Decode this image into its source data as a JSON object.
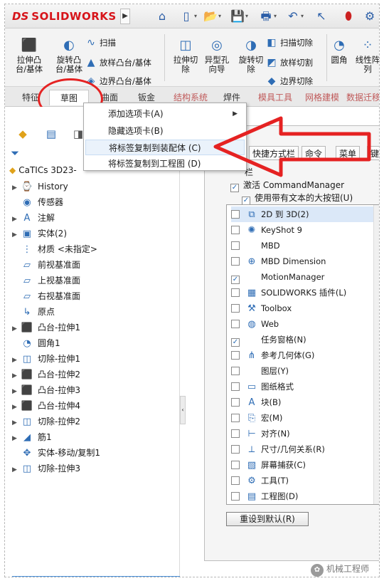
{
  "app": {
    "logo_ds": "DS",
    "logo_name": "SOLIDWORKS"
  },
  "quick_access": [
    "home-icon",
    "new-icon",
    "open-icon",
    "save-icon",
    "print-icon",
    "undo-icon",
    "traffic-light-icon"
  ],
  "ribbon": {
    "extrude_boss": "拉伸凸\n台/基体",
    "revolve_boss": "旋转凸\n台/基体",
    "sweep": "扫描",
    "loft_boss": "放样凸台/基体",
    "boundary_boss": "边界凸台/基体",
    "extrude_cut": "拉伸切\n除",
    "hole_wizard": "异型孔\n向导",
    "revolve_cut": "旋转切\n除",
    "sweep_cut": "扫描切除",
    "loft_cut": "放样切割",
    "boundary_cut": "边界切除",
    "fillet": "圆角",
    "linear_pattern": "线性阵\n列"
  },
  "tabs": [
    "特征",
    "草图",
    "曲面",
    "钣金",
    "结构系统",
    "焊件",
    "模具工具",
    "网格建模",
    "数据迁移"
  ],
  "context_menu": {
    "add_tab": "添加选项卡(A)",
    "hide_tab": "隐藏选项卡(B)",
    "copy_to_assembly": "将标签复制到装配体 (C)",
    "copy_to_drawing": "将标签复制到工程图 (D)"
  },
  "feature_tree": {
    "root": "CaTICs 3D23-",
    "items": [
      {
        "label": "History",
        "expand": true,
        "icon": "history-icon"
      },
      {
        "label": "传感器",
        "expand": false,
        "icon": "sensor-icon"
      },
      {
        "label": "注解",
        "expand": true,
        "icon": "annotation-icon"
      },
      {
        "label": "实体(2)",
        "expand": true,
        "icon": "solid-bodies-icon"
      },
      {
        "label": "材质 <未指定>",
        "expand": false,
        "icon": "material-icon"
      },
      {
        "label": "前视基准面",
        "expand": false,
        "icon": "plane-icon"
      },
      {
        "label": "上视基准面",
        "expand": false,
        "icon": "plane-icon"
      },
      {
        "label": "右视基准面",
        "expand": false,
        "icon": "plane-icon"
      },
      {
        "label": "原点",
        "expand": false,
        "icon": "origin-icon"
      },
      {
        "label": "凸台-拉伸1",
        "expand": true,
        "icon": "boss-extrude-icon"
      },
      {
        "label": "圆角1",
        "expand": false,
        "icon": "fillet-icon"
      },
      {
        "label": "切除-拉伸1",
        "expand": true,
        "icon": "cut-extrude-icon"
      },
      {
        "label": "凸台-拉伸2",
        "expand": true,
        "icon": "boss-extrude-icon"
      },
      {
        "label": "凸台-拉伸3",
        "expand": true,
        "icon": "boss-extrude-icon"
      },
      {
        "label": "凸台-拉伸4",
        "expand": true,
        "icon": "boss-extrude-icon"
      },
      {
        "label": "切除-拉伸2",
        "expand": true,
        "icon": "cut-extrude-icon"
      },
      {
        "label": "筋1",
        "expand": true,
        "icon": "rib-icon"
      },
      {
        "label": "实体-移动/复制1",
        "expand": false,
        "icon": "move-copy-icon"
      },
      {
        "label": "切除-拉伸3",
        "expand": true,
        "icon": "cut-extrude-icon"
      }
    ]
  },
  "dialog": {
    "tabs": [
      "快捷方式栏",
      "命令",
      "菜单",
      "键"
    ],
    "section_label": "栏",
    "activate_cm": "激活 CommandManager",
    "large_buttons": "使用带有文本的大按钮(U)",
    "list": [
      {
        "label": "2D 到 3D(2)",
        "checked": false,
        "selected": true,
        "icon": "2d-to-3d-icon"
      },
      {
        "label": "KeyShot 9",
        "checked": false,
        "icon": "keyshot-icon"
      },
      {
        "label": "MBD",
        "checked": false,
        "icon": ""
      },
      {
        "label": "MBD Dimension",
        "checked": false,
        "icon": "mbd-dimension-icon"
      },
      {
        "label": "MotionManager",
        "checked": true,
        "icon": ""
      },
      {
        "label": "SOLIDWORKS 插件(L)",
        "checked": false,
        "icon": "addins-icon"
      },
      {
        "label": "Toolbox",
        "checked": false,
        "icon": "toolbox-icon"
      },
      {
        "label": "Web",
        "checked": false,
        "icon": "web-icon"
      },
      {
        "label": "任务窗格(N)",
        "checked": true,
        "icon": ""
      },
      {
        "label": "参考几何体(G)",
        "checked": false,
        "icon": "reference-geometry-icon"
      },
      {
        "label": "图层(Y)",
        "checked": false,
        "icon": ""
      },
      {
        "label": "图纸格式",
        "checked": false,
        "icon": "sheet-format-icon"
      },
      {
        "label": "块(B)",
        "checked": false,
        "icon": "block-icon"
      },
      {
        "label": "宏(M)",
        "checked": false,
        "icon": "macro-icon"
      },
      {
        "label": "对齐(N)",
        "checked": false,
        "icon": "align-icon"
      },
      {
        "label": "尺寸/几何关系(R)",
        "checked": false,
        "icon": "dimension-icon"
      },
      {
        "label": "屏幕捕获(C)",
        "checked": false,
        "icon": "screen-capture-icon"
      },
      {
        "label": "工具(T)",
        "checked": false,
        "icon": "tools-icon"
      },
      {
        "label": "工程图(D)",
        "checked": false,
        "icon": "drawing-icon"
      }
    ],
    "reset": "重设到默认(R)"
  },
  "watermark": "机械工程师",
  "colors": {
    "accent_red": "#e52222",
    "brand_red": "#d7141a",
    "select_blue": "#4a90d9"
  }
}
